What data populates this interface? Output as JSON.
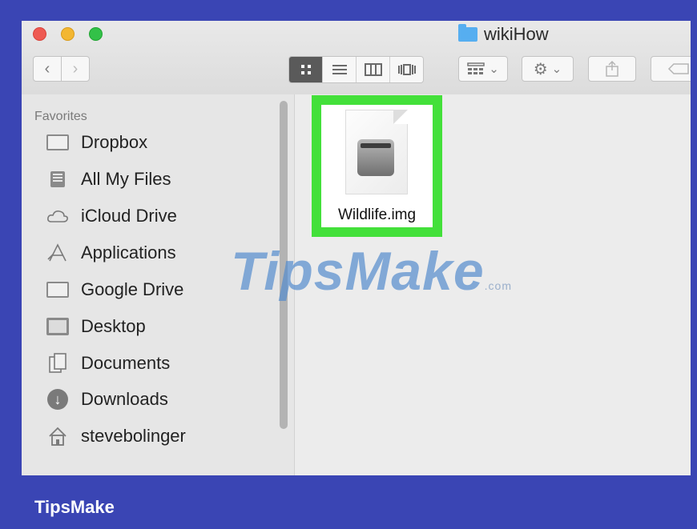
{
  "window": {
    "title": "wikiHow"
  },
  "toolbar": {
    "back_icon": "chevron-left-icon",
    "forward_icon": "chevron-right-icon",
    "view_modes": [
      "icon-view",
      "list-view",
      "column-view",
      "cover-flow-view"
    ],
    "arrange_icon": "arrange-icon",
    "action_icon": "gear-icon",
    "share_icon": "share-icon",
    "tag_icon": "tag-icon"
  },
  "sidebar": {
    "section": "Favorites",
    "items": [
      {
        "label": "Dropbox",
        "icon": "folder-icon"
      },
      {
        "label": "All My Files",
        "icon": "all-files-icon"
      },
      {
        "label": "iCloud Drive",
        "icon": "cloud-icon"
      },
      {
        "label": "Applications",
        "icon": "applications-icon"
      },
      {
        "label": "Google Drive",
        "icon": "folder-icon"
      },
      {
        "label": "Desktop",
        "icon": "desktop-icon"
      },
      {
        "label": "Documents",
        "icon": "documents-icon"
      },
      {
        "label": "Downloads",
        "icon": "download-icon"
      },
      {
        "label": "stevebolinger",
        "icon": "home-icon"
      }
    ]
  },
  "files": [
    {
      "name": "Wildlife.img",
      "icon": "disk-image-icon",
      "highlight_color": "#43e03a"
    }
  ],
  "watermark": {
    "text": "TipsMake",
    "suffix": ".com"
  },
  "footer": {
    "brand": "TipsMake"
  },
  "colors": {
    "frame": "#3a45b4",
    "highlight": "#43e03a",
    "folder_blue": "#56aef0"
  }
}
